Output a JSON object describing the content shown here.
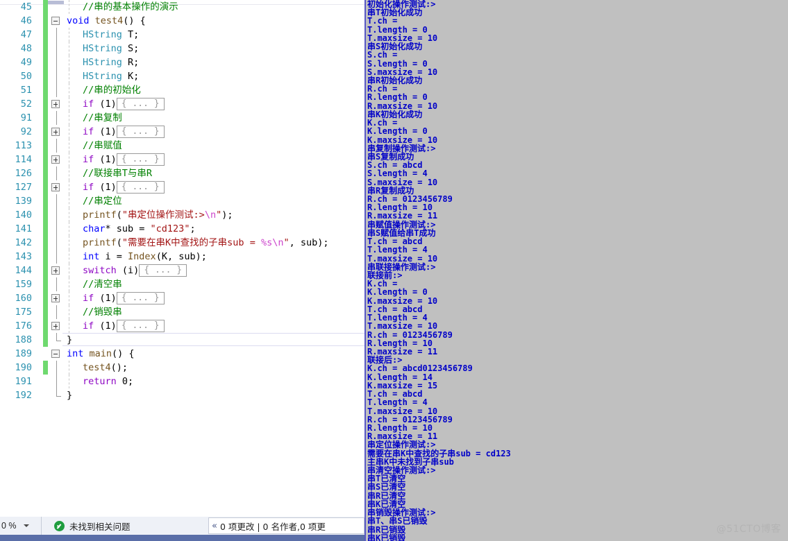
{
  "editor": {
    "language": "cpp",
    "lines": [
      {
        "num": "45",
        "change": true,
        "fold": "",
        "indent": 1,
        "html": "<span class='cm'>//串的基本操作的演示</span>"
      },
      {
        "num": "46",
        "change": true,
        "fold": "minus",
        "indent": 0,
        "html": "<span class='k'>void</span> <span class='fn'>test4</span><span class='pl'>() {</span>"
      },
      {
        "num": "47",
        "change": true,
        "fold": "rail",
        "indent": 1,
        "html": "<span class='ty'>HString</span> <span class='pl'>T;</span>"
      },
      {
        "num": "48",
        "change": true,
        "fold": "rail",
        "indent": 1,
        "html": "<span class='ty'>HString</span> <span class='pl'>S;</span>"
      },
      {
        "num": "49",
        "change": true,
        "fold": "rail",
        "indent": 1,
        "html": "<span class='ty'>HString</span> <span class='pl'>R;</span>"
      },
      {
        "num": "50",
        "change": true,
        "fold": "rail",
        "indent": 1,
        "html": "<span class='ty'>HString</span> <span class='pl'>K;</span>"
      },
      {
        "num": "51",
        "change": true,
        "fold": "rail",
        "indent": 1,
        "html": "<span class='cm'>//串的初始化</span>"
      },
      {
        "num": "52",
        "change": true,
        "fold": "plus",
        "indent": 1,
        "html": "<span class='kp'>if</span> <span class='pl'>(1)</span><span class='collapsed'>{ ... }</span>"
      },
      {
        "num": "91",
        "change": true,
        "fold": "rail",
        "indent": 1,
        "html": "<span class='cm'>//串复制</span>"
      },
      {
        "num": "92",
        "change": true,
        "fold": "plus",
        "indent": 1,
        "html": "<span class='kp'>if</span> <span class='pl'>(1)</span><span class='collapsed'>{ ... }</span>"
      },
      {
        "num": "113",
        "change": true,
        "fold": "rail",
        "indent": 1,
        "html": "<span class='cm'>//串赋值</span>"
      },
      {
        "num": "114",
        "change": true,
        "fold": "plus",
        "indent": 1,
        "html": "<span class='kp'>if</span> <span class='pl'>(1)</span><span class='collapsed'>{ ... }</span>"
      },
      {
        "num": "126",
        "change": true,
        "fold": "rail",
        "indent": 1,
        "html": "<span class='cm'>//联接串T与串R</span>"
      },
      {
        "num": "127",
        "change": true,
        "fold": "plus",
        "indent": 1,
        "html": "<span class='kp'>if</span> <span class='pl'>(1)</span><span class='collapsed'>{ ... }</span>"
      },
      {
        "num": "139",
        "change": true,
        "fold": "rail",
        "indent": 1,
        "html": "<span class='cm'>//串定位</span>"
      },
      {
        "num": "140",
        "change": true,
        "fold": "rail",
        "indent": 1,
        "html": "<span class='fn'>printf</span><span class='pl'>(</span><span class='st'>\"串定位操作测试:&gt;</span><span class='esc'>\\n</span><span class='st'>\"</span><span class='pl'>);</span>"
      },
      {
        "num": "141",
        "change": true,
        "fold": "rail",
        "indent": 1,
        "html": "<span class='k'>char</span><span class='pl'>* sub = </span><span class='st'>\"cd123\"</span><span class='pl'>;</span>"
      },
      {
        "num": "142",
        "change": true,
        "fold": "rail",
        "indent": 1,
        "html": "<span class='fn'>printf</span><span class='pl'>(</span><span class='st'>\"需要在串K中查找的子串sub = </span><span class='esc'>%s\\n</span><span class='st'>\"</span><span class='pl'>, sub);</span>"
      },
      {
        "num": "143",
        "change": true,
        "fold": "rail",
        "indent": 1,
        "html": "<span class='k'>int</span> <span class='pl'>i = </span><span class='fn'>Index</span><span class='pl'>(K, sub);</span>"
      },
      {
        "num": "144",
        "change": true,
        "fold": "plus",
        "indent": 1,
        "html": "<span class='kp'>switch</span> <span class='pl'>(i)</span><span class='collapsed'>{ ... }</span>"
      },
      {
        "num": "159",
        "change": true,
        "fold": "rail",
        "indent": 1,
        "html": "<span class='cm'>//清空串</span>"
      },
      {
        "num": "160",
        "change": true,
        "fold": "plus",
        "indent": 1,
        "html": "<span class='kp'>if</span> <span class='pl'>(1)</span><span class='collapsed'>{ ... }</span>"
      },
      {
        "num": "175",
        "change": true,
        "fold": "rail",
        "indent": 1,
        "html": "<span class='cm'>//销毁串</span>"
      },
      {
        "num": "176",
        "change": true,
        "fold": "plus",
        "indent": 1,
        "html": "<span class='kp'>if</span> <span class='pl'>(1)</span><span class='collapsed'>{ ... }</span>"
      },
      {
        "num": "188",
        "change": true,
        "fold": "elbow",
        "indent": 0,
        "current": true,
        "html": "<span class='pl'>}</span>"
      },
      {
        "num": "189",
        "change": false,
        "fold": "minus",
        "indent": 0,
        "html": "<span class='k'>int</span> <span class='fn'>main</span><span class='pl'>() {</span>"
      },
      {
        "num": "190",
        "change": true,
        "fold": "rail",
        "indent": 1,
        "html": "<span class='fn'>test4</span><span class='pl'>();</span>"
      },
      {
        "num": "191",
        "change": false,
        "fold": "rail",
        "indent": 1,
        "html": "<span class='kp'>return</span> <span class='pl'>0;</span>"
      },
      {
        "num": "192",
        "change": false,
        "fold": "elbow",
        "indent": 0,
        "html": "<span class='pl'>}</span>"
      }
    ]
  },
  "console": {
    "title": "console-output",
    "lines": [
      "初始化操作测试:>",
      "串T初始化成功",
      "T.ch =",
      "T.length = 0",
      "T.maxsize = 10",
      "串S初始化成功",
      "S.ch =",
      "S.length = 0",
      "S.maxsize = 10",
      "串R初始化成功",
      "R.ch =",
      "R.length = 0",
      "R.maxsize = 10",
      "串K初始化成功",
      "K.ch =",
      "K.length = 0",
      "K.maxsize = 10",
      "串复制操作测试:>",
      "串S复制成功",
      "S.ch = abcd",
      "S.length = 4",
      "S.maxsize = 10",
      "串R复制成功",
      "R.ch = 0123456789",
      "R.length = 10",
      "R.maxsize = 11",
      "串赋值操作测试:>",
      "串S赋值给串T成功",
      "T.ch = abcd",
      "T.length = 4",
      "T.maxsize = 10",
      "串联接操作测试:>",
      "联接前:>",
      "K.ch =",
      "K.length = 0",
      "K.maxsize = 10",
      "T.ch = abcd",
      "T.length = 4",
      "T.maxsize = 10",
      "R.ch = 0123456789",
      "R.length = 10",
      "R.maxsize = 11",
      "联接后:>",
      "K.ch = abcd0123456789",
      "K.length = 14",
      "K.maxsize = 15",
      "T.ch = abcd",
      "T.length = 4",
      "T.maxsize = 10",
      "R.ch = 0123456789",
      "R.length = 10",
      "R.maxsize = 11",
      "串定位操作测试:>",
      "需要在串K中查找的子串sub = cd123",
      "主串K中未找到子串sub",
      "串清空操作测试:>",
      "串T已清空",
      "串S已清空",
      "串R已清空",
      "串K已清空",
      "串销毁操作测试:>",
      "串T、串S已销毁",
      "串R已销毁",
      "串K已销毁"
    ],
    "watermark": "@51CTO博客"
  },
  "statusbar": {
    "zoom_value": "0 %",
    "issues_text": "未找到相关问题",
    "codelens_text": "0 项更改 | 0 名作者,0 项更",
    "codelens_chevron": "«"
  },
  "colors": {
    "console_bg": "#c0c0c0",
    "console_text": "#0000c8",
    "editor_bg": "#ffffff",
    "line_number": "#2b91af",
    "comment": "#008000",
    "string": "#a31515",
    "keyword": "#0000ff",
    "control_keyword": "#8f08c4",
    "type": "#2b91af",
    "function": "#74531f",
    "change_margin": "#6fd96f",
    "status_band": "#5a6ea8",
    "ok_green": "#1f9d3f"
  }
}
